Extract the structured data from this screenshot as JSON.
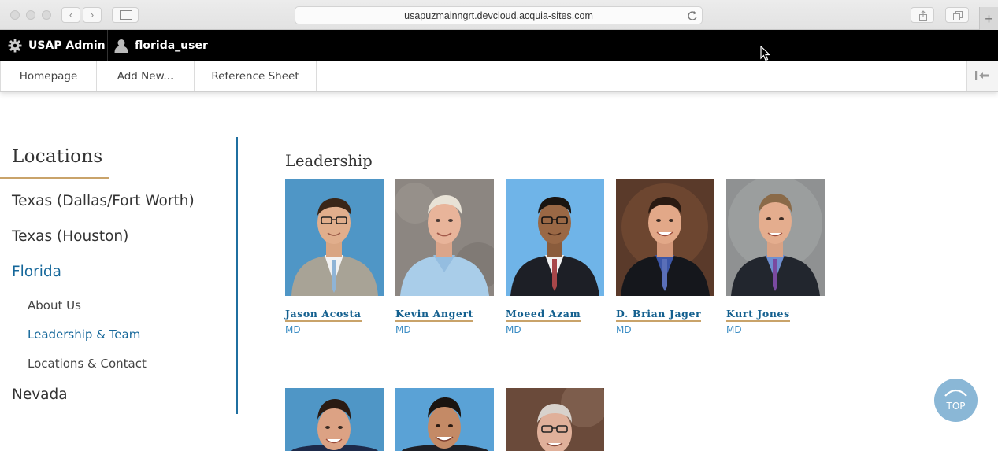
{
  "browser": {
    "url": "usapuzmainngrt.devcloud.acquia-sites.com",
    "icons": [
      "back-icon",
      "forward-icon",
      "sidebar-icon",
      "reload-icon",
      "share-icon",
      "tabs-icon",
      "new-tab-icon"
    ]
  },
  "admin_bar": {
    "admin_label": "USAP Admin",
    "user_label": "florida_user"
  },
  "tray": {
    "tabs": [
      "Homepage",
      "Add New...",
      "Reference Sheet"
    ]
  },
  "sidebar": {
    "title": "Locations",
    "items": [
      {
        "label": "Texas (Dallas/Fort Worth)"
      },
      {
        "label": "Texas (Houston)"
      },
      {
        "label": "Florida"
      },
      {
        "label": "Nevada"
      }
    ],
    "sub_items": [
      {
        "label": "About Us"
      },
      {
        "label": "Leadership & Team"
      },
      {
        "label": "Locations & Contact"
      }
    ]
  },
  "main": {
    "section_title": "Leadership",
    "people": [
      {
        "name": "Jason Acosta",
        "credential": "MD"
      },
      {
        "name": "Kevin Angert",
        "credential": "MD"
      },
      {
        "name": "Moeed Azam",
        "credential": "MD"
      },
      {
        "name": "D. Brian Jager",
        "credential": "MD"
      },
      {
        "name": "Kurt Jones",
        "credential": "MD"
      }
    ]
  },
  "top_button": {
    "label": "TOP"
  },
  "colors": {
    "accent": "#15679a",
    "underline_gold": "#c9a36a",
    "credential_blue": "#3a8cc4",
    "top_button": "#8ab7d6"
  }
}
